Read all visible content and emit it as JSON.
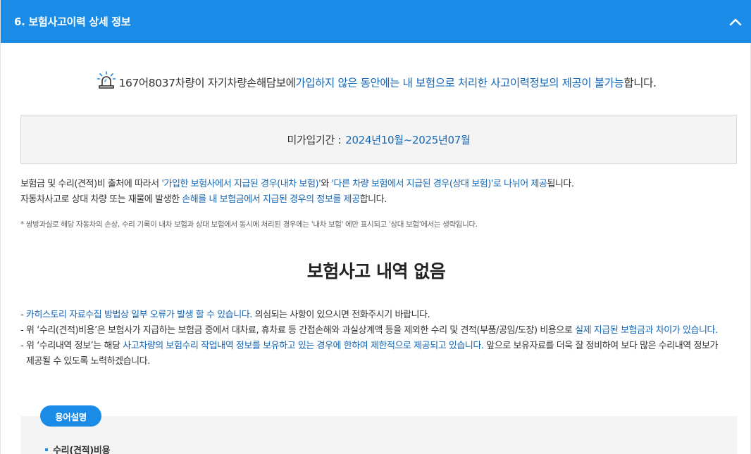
{
  "header": {
    "title": "6. 보험사고이력 상세 정보",
    "collapse_icon": "chevron-up-icon"
  },
  "notice": {
    "icon": "siren-icon",
    "plate": "167어8037",
    "text_a": " 차량이 자기차량손해담보에 ",
    "text_b_blue": "가입하지 않은 동안에는 내 보험으로 처리한 사고이력정보의 제공이 불가능",
    "text_c": "합니다."
  },
  "period": {
    "label": "미가입기간 :",
    "value": "2024년10월~2025년07월"
  },
  "description": {
    "line1_a": "보험금 및 수리(견적)비 출처에 따라서 ",
    "line1_b_blue": "'가입한 보험사에서 지급된 경우(내차 보험)'",
    "line1_c": "와 ",
    "line1_d_blue": "'다른 차량 보험에서 지급된 경우(상대 보험)'로 나뉘어 제공",
    "line1_e": "됩니다.",
    "line2_a": "자동차사고로 상대 차량 또는 재물에 발생한 ",
    "line2_b_blue": "손해를 내 보험금에서 지급된 경우의 정보를 제공",
    "line2_c": "합니다."
  },
  "footnote": "* 쌍방과실로 해당 자동차의 손상, 수리 기록이 내차 보험과 상대 보험에서 동시에 처리된 경우에는 '내차 보험' 에만 표시되고 '상대 보험'에서는 생략됩니다.",
  "no_history": "보험사고 내역 없음",
  "notes": {
    "dash": "-",
    "n1_blue": "카히스토리 자료수집 방법상 일부 오류가 발생 할 수 있습니다.",
    "n1_rest": " 의심되는 사항이 있으시면 전화주시기 바랍니다.",
    "n2_a": "위 ‘수리(견적)비용’은 보험사가 지급하는 보험금 중에서 대차료, 휴차료 등 간접손해와 과실상계액 등을 제외한 수리 및 견적(부품/공임/도장) 비용으로 ",
    "n2_b_blue": "실제 지급된 보험금과 차이가 있습니다.",
    "n3_a": "위 ‘수리내역 정보’는 해당 ",
    "n3_b_blue": "사고차량의 보험수리 작업내역 정보를 보유하고 있는 경우에 한하여 제한적으로 제공되고 있습니다.",
    "n3_c": " 앞으로 보유자료를 더욱 잘 정비하여 보다 많은 수리내역 정보가 제공될 수 있도록 노력하겠습니다."
  },
  "terms": {
    "badge": "용어설명",
    "item1": "수리(견적)비용"
  },
  "colors": {
    "header_bg": "#1a8be6",
    "accent_text": "#1566b5",
    "box_bg": "#f4f4f4"
  }
}
